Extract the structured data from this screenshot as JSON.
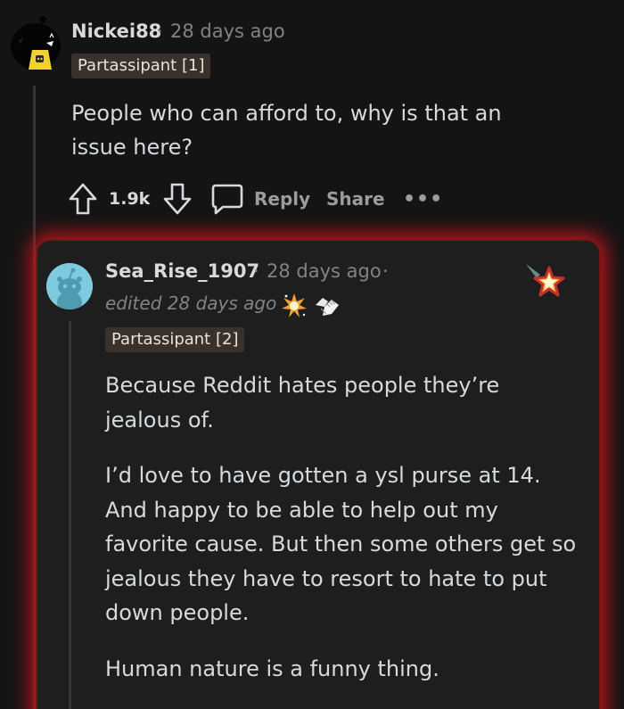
{
  "top_comment": {
    "username": "Nickei88",
    "separator": "·",
    "time": "28 days ago",
    "flair": "Partassipant [1]",
    "body": "People who can afford to, why is that an issue here?",
    "actions": {
      "score": "1.9k",
      "reply_label": "Reply",
      "share_label": "Share",
      "more_label": "•••"
    }
  },
  "reply_comment": {
    "username": "Sea_Rise_1907",
    "separator": "·",
    "time": "28 days ago",
    "trailing_separator": "·",
    "edited": "edited 28 days ago",
    "flair": "Partassipant [2]",
    "paragraphs": [
      "Because Reddit hates people they’re jealous of.",
      "I’d love to have gotten a ysl purse at 14. And happy to be able to help out my favorite cause. But then some others get so jealous they have to resort to hate to put down people.",
      "Human nature is a funny thing."
    ]
  },
  "colors": {
    "background": "#141414",
    "card": "#1e1e1e",
    "highlight_glow": "#c0161c",
    "flair_bg": "#3a302c",
    "muted_text": "#818384",
    "avatar_blue": "#7ecbe0"
  },
  "icons": [
    "snoo-avatar-icon",
    "upvote-icon",
    "downvote-icon",
    "comment-icon",
    "more-icon",
    "award-burst-icon",
    "award-hands-icon",
    "award-star-icon"
  ]
}
